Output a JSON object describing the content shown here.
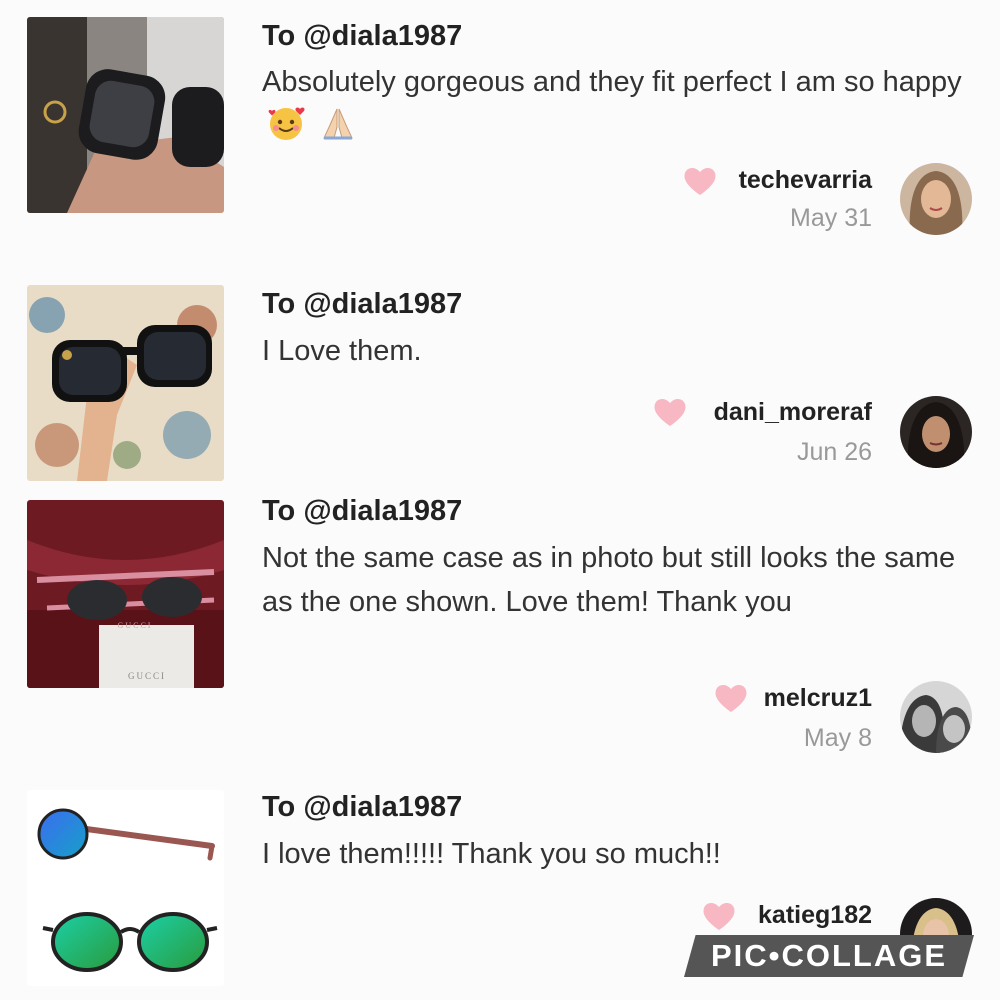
{
  "reviews": [
    {
      "to": "To @diala1987",
      "text": "Absolutely gorgeous and they fit perfect I am so happy",
      "emojis": [
        "smiling-face-with-hearts-emoji",
        "folded-hands-emoji"
      ],
      "reviewer": "techevarria",
      "date": "May 31",
      "thumb_icon": "photo-held-sunglasses",
      "avatar_icon": "reviewer-avatar"
    },
    {
      "to": "To @diala1987",
      "text": "I Love them.",
      "reviewer": "dani_moreraf",
      "date": "Jun 26",
      "thumb_icon": "photo-held-sunglasses-patterned",
      "avatar_icon": "reviewer-avatar"
    },
    {
      "to": "To @diala1987",
      "text": "Not the same case as in photo but still looks the same as the one shown. Love them! Thank you",
      "reviewer": "melcruz1",
      "date": "May 8",
      "thumb_icon": "photo-sunglasses-case",
      "thumb_case_text": "GUCCI",
      "avatar_icon": "reviewer-avatar"
    },
    {
      "to": "To @diala1987",
      "text": "I love them!!!!! Thank you so much!!",
      "reviewer": "katieg182",
      "thumb_icon": "photo-product-sunglasses",
      "avatar_icon": "reviewer-avatar"
    }
  ],
  "watermark": "PIC•COLLAGE",
  "colors": {
    "heart": "#f7b8c3",
    "date": "#999999",
    "watermark_bg": "#555555"
  }
}
